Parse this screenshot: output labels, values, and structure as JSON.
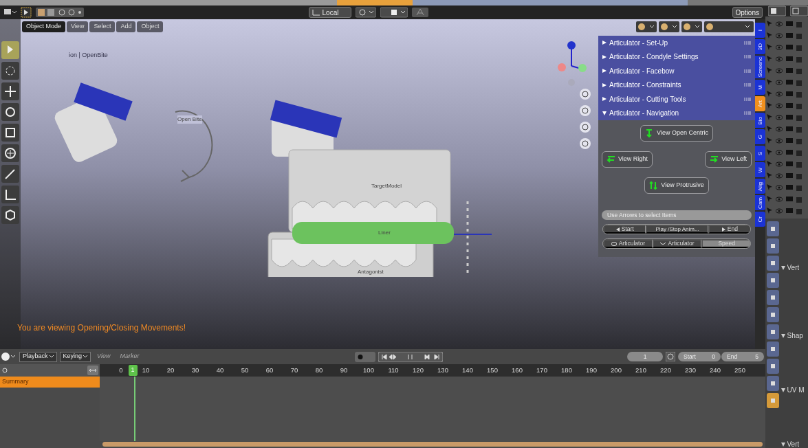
{
  "header": {
    "orientation": "Local",
    "options": "Options"
  },
  "toolbar": [
    {
      "kind": "select",
      "selected": true
    },
    {
      "kind": "cursor",
      "selected": false
    },
    {
      "kind": "move",
      "selected": false
    },
    {
      "kind": "rotate",
      "selected": false
    },
    {
      "kind": "scale",
      "selected": false
    },
    {
      "kind": "transform",
      "selected": false
    },
    {
      "kind": "annotate",
      "selected": false
    },
    {
      "kind": "measure",
      "selected": false
    },
    {
      "kind": "cube",
      "selected": false
    }
  ],
  "viewport": {
    "mode": "Object Mode",
    "menus": [
      "View",
      "Select",
      "Add",
      "Object"
    ],
    "view_info": "ion | OpenBite",
    "labels": {
      "arc": "Open Bite",
      "upper": "TargetModel",
      "liner": "Liner",
      "lower": "Antagonist"
    },
    "message": "You are viewing Opening/Closing Movements!"
  },
  "panel": {
    "sections": [
      {
        "title": "Articulator - Set-Up",
        "expanded": false
      },
      {
        "title": "Articulator - Condyle Settings",
        "expanded": false
      },
      {
        "title": "Articulator -  Facebow",
        "expanded": false
      },
      {
        "title": "Articulator - Constraints",
        "expanded": false
      },
      {
        "title": "Articulator - Cutting Tools",
        "expanded": false
      },
      {
        "title": "Articulator - Navigation",
        "expanded": true
      }
    ],
    "nav_buttons": [
      {
        "label": "View Open Centric",
        "kind": "down"
      },
      {
        "label": "View Right",
        "kind": "left"
      },
      {
        "label": "View Left",
        "kind": "right"
      },
      {
        "label": "View Protrusive",
        "kind": "swap"
      }
    ],
    "hint": "Use Arrows to select Items",
    "playback": [
      "Start",
      "Play /Stop Anim...",
      "End"
    ],
    "controls": [
      "Articulator",
      "Articulator",
      "Speed"
    ]
  },
  "side_tabs": [
    {
      "label": "I",
      "selected": false
    },
    {
      "label": "3D",
      "selected": false
    },
    {
      "label": "Screenc",
      "selected": false
    },
    {
      "label": "M",
      "selected": false
    },
    {
      "label": "Art",
      "selected": true
    },
    {
      "label": "Bio",
      "selected": false
    },
    {
      "label": "G",
      "selected": false
    },
    {
      "label": "S",
      "selected": false
    },
    {
      "label": "W",
      "selected": false
    },
    {
      "label": "Alig",
      "selected": false
    },
    {
      "label": "Cam",
      "selected": false
    },
    {
      "label": "Cr",
      "selected": false
    }
  ],
  "properties": {
    "headers": [
      "Vert",
      "Shap",
      "UV M",
      "Vert"
    ]
  },
  "timeline": {
    "menus": [
      {
        "label": "Playback",
        "disabled": false
      },
      {
        "label": "Keying",
        "disabled": false
      },
      {
        "label": "View",
        "disabled": true
      },
      {
        "label": "Marker",
        "disabled": true
      }
    ],
    "current_frame": "1",
    "marker_frame": "1",
    "start_label": "Start",
    "start": "0",
    "end_label": "End",
    "end": "5",
    "ticks": [
      "0",
      "10",
      "20",
      "30",
      "40",
      "50",
      "60",
      "70",
      "80",
      "90",
      "100",
      "110",
      "120",
      "130",
      "140",
      "150",
      "160",
      "170",
      "180",
      "190",
      "200",
      "210",
      "220",
      "230",
      "240",
      "250"
    ],
    "channels": [
      {
        "label": "Summary",
        "selected": true
      }
    ]
  }
}
